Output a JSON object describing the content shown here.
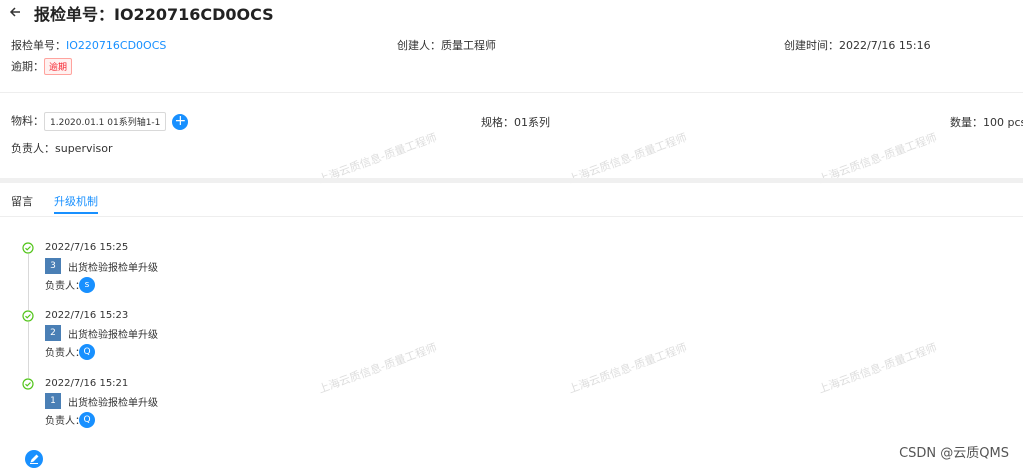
{
  "header": {
    "back_icon": "arrow-left-icon",
    "title": "报检单号：IO220716CD0OCS"
  },
  "info": {
    "inspection_no_label": "报检单号：",
    "inspection_no_value": "IO220716CD0OCS",
    "creator_label": "创建人：",
    "creator_value": "质量工程师",
    "created_time_label": "创建时间：",
    "created_time_value": "2022/7/16 15:16",
    "overdue_label": "逾期：",
    "overdue_badge": "逾期"
  },
  "material": {
    "label": "物料：",
    "selected": "1.2020.01.1 01系列轴1-1",
    "spec_label": "规格：",
    "spec_value": "01系列",
    "qty_label": "数量：",
    "qty_value": "100 pcs",
    "owner_label": "负责人：",
    "owner_value": "supervisor"
  },
  "tabs": [
    {
      "label": "留言"
    },
    {
      "label": "升级机制"
    }
  ],
  "timeline": [
    {
      "time": "2022/7/16 15:25",
      "level": "3",
      "title": "出货检验报检单升级",
      "owner_label": "负责人：",
      "avatar": "s"
    },
    {
      "time": "2022/7/16 15:23",
      "level": "2",
      "title": "出货检验报检单升级",
      "owner_label": "负责人：",
      "avatar": "Q"
    },
    {
      "time": "2022/7/16 15:21",
      "level": "1",
      "title": "出货检验报检单升级",
      "owner_label": "负责人：",
      "avatar": "Q"
    }
  ],
  "watermark_text": "上海云质信息-质量工程师",
  "footer_mark": "CSDN @云质QMS",
  "colors": {
    "primary": "#1890ff",
    "danger": "#f5222d",
    "level_badge": "#4a7fb5"
  }
}
